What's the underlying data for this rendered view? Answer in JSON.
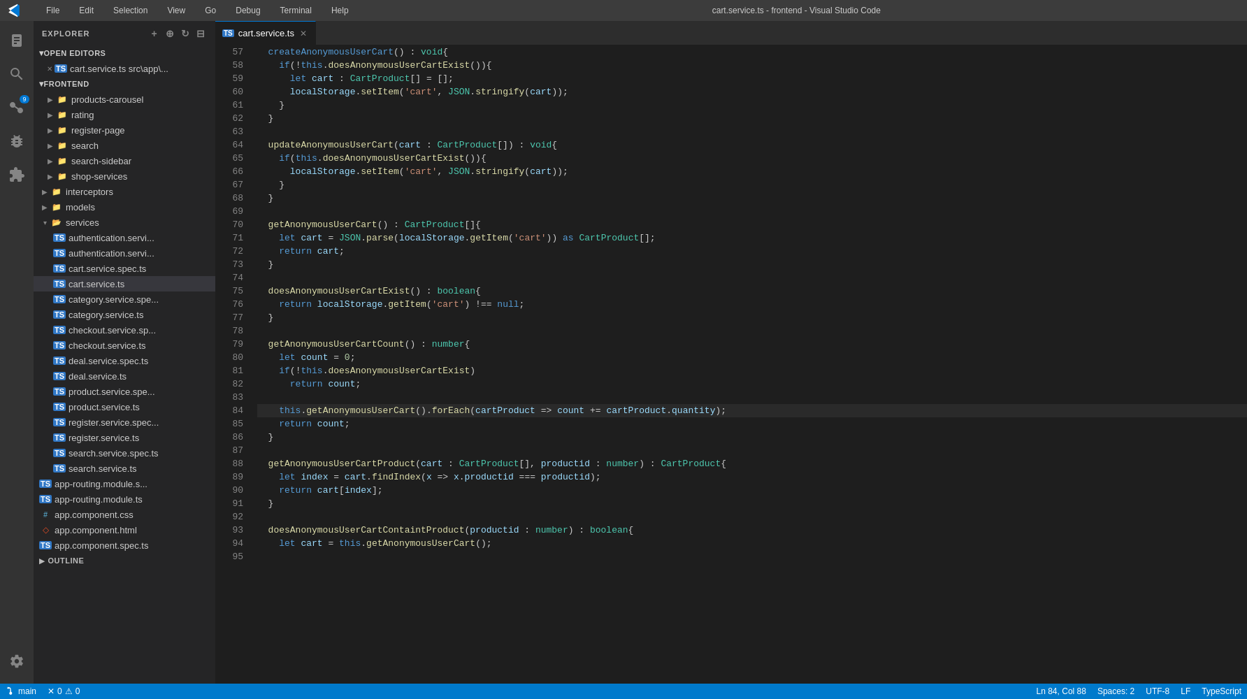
{
  "titlebar": {
    "title": "cart.service.ts - frontend - Visual Studio Code",
    "menus": [
      "File",
      "Edit",
      "Selection",
      "View",
      "Go",
      "Debug",
      "Terminal",
      "Help"
    ]
  },
  "activity_bar": {
    "icons": [
      {
        "name": "explorer",
        "symbol": "⎘",
        "active": false
      },
      {
        "name": "search",
        "symbol": "🔍",
        "active": false
      },
      {
        "name": "source-control",
        "symbol": "⑂",
        "active": false,
        "badge": "9"
      },
      {
        "name": "debug",
        "symbol": "🐛",
        "active": false
      },
      {
        "name": "extensions",
        "symbol": "⊞",
        "active": false
      }
    ],
    "gear_symbol": "⚙"
  },
  "sidebar": {
    "title": "Explorer",
    "sections": {
      "open_editors": {
        "label": "Open Editors",
        "files": [
          {
            "name": "cart.service.ts",
            "path": "src\\app\\...",
            "type": "ts"
          }
        ]
      },
      "frontend": {
        "label": "FRONTEND",
        "tree": [
          {
            "label": "products-carousel",
            "type": "folder",
            "depth": 1,
            "collapsed": true
          },
          {
            "label": "rating",
            "type": "folder",
            "depth": 1,
            "collapsed": true
          },
          {
            "label": "register-page",
            "type": "folder",
            "depth": 1,
            "collapsed": true
          },
          {
            "label": "search",
            "type": "folder",
            "depth": 1,
            "collapsed": true
          },
          {
            "label": "search-sidebar",
            "type": "folder",
            "depth": 1,
            "collapsed": true
          },
          {
            "label": "shop-services",
            "type": "folder",
            "depth": 1,
            "collapsed": true
          },
          {
            "label": "interceptors",
            "type": "folder",
            "depth": 0,
            "collapsed": true
          },
          {
            "label": "models",
            "type": "folder",
            "depth": 0,
            "collapsed": true
          },
          {
            "label": "services",
            "type": "folder",
            "depth": 0,
            "collapsed": false
          },
          {
            "label": "authentication.servi...",
            "type": "ts",
            "depth": 1
          },
          {
            "label": "authentication.servi...",
            "type": "ts",
            "depth": 1
          },
          {
            "label": "cart.service.spec.ts",
            "type": "ts",
            "depth": 1
          },
          {
            "label": "cart.service.ts",
            "type": "ts",
            "depth": 1,
            "active": true
          },
          {
            "label": "category.service.spe...",
            "type": "ts",
            "depth": 1
          },
          {
            "label": "category.service.ts",
            "type": "ts",
            "depth": 1
          },
          {
            "label": "checkout.service.sp...",
            "type": "ts",
            "depth": 1
          },
          {
            "label": "checkout.service.ts",
            "type": "ts",
            "depth": 1
          },
          {
            "label": "deal.service.spec.ts",
            "type": "ts",
            "depth": 1
          },
          {
            "label": "deal.service.ts",
            "type": "ts",
            "depth": 1
          },
          {
            "label": "product.service.spe...",
            "type": "ts",
            "depth": 1
          },
          {
            "label": "product.service.ts",
            "type": "ts",
            "depth": 1
          },
          {
            "label": "register.service.spec...",
            "type": "ts",
            "depth": 1
          },
          {
            "label": "register.service.ts",
            "type": "ts",
            "depth": 1
          },
          {
            "label": "search.service.spec.ts",
            "type": "ts",
            "depth": 1
          },
          {
            "label": "search.service.ts",
            "type": "ts",
            "depth": 1
          },
          {
            "label": "app-routing.module.s...",
            "type": "ts",
            "depth": 0
          },
          {
            "label": "app-routing.module.ts",
            "type": "ts",
            "depth": 0
          },
          {
            "label": "app.component.css",
            "type": "css",
            "depth": 0
          },
          {
            "label": "app.component.html",
            "type": "html",
            "depth": 0
          },
          {
            "label": "app.component.spec.ts",
            "type": "ts",
            "depth": 0
          }
        ]
      },
      "outline": {
        "label": "OUTLINE"
      }
    }
  },
  "editor": {
    "tab": {
      "filename": "cart.service.ts",
      "type": "ts"
    },
    "lines": [
      {
        "num": 57,
        "code": "  createAnonymousUserCart() : void{"
      },
      {
        "num": 58,
        "code": "    if(!this.doesAnonymousUserCartExist()){"
      },
      {
        "num": 59,
        "code": "      let cart : CartProduct[] = [];"
      },
      {
        "num": 60,
        "code": "      localStorage.setItem('cart', JSON.stringify(cart));"
      },
      {
        "num": 61,
        "code": "    }"
      },
      {
        "num": 62,
        "code": "  }"
      },
      {
        "num": 63,
        "code": ""
      },
      {
        "num": 64,
        "code": "  updateAnonymousUserCart(cart : CartProduct[]) : void{"
      },
      {
        "num": 65,
        "code": "    if(this.doesAnonymousUserCartExist()){"
      },
      {
        "num": 66,
        "code": "      localStorage.setItem('cart', JSON.stringify(cart));"
      },
      {
        "num": 67,
        "code": "    }"
      },
      {
        "num": 68,
        "code": "  }"
      },
      {
        "num": 69,
        "code": ""
      },
      {
        "num": 70,
        "code": "  getAnonymousUserCart() : CartProduct[]{"
      },
      {
        "num": 71,
        "code": "    let cart = JSON.parse(localStorage.getItem('cart')) as CartProduct[];"
      },
      {
        "num": 72,
        "code": "    return cart;"
      },
      {
        "num": 73,
        "code": "  }"
      },
      {
        "num": 74,
        "code": ""
      },
      {
        "num": 75,
        "code": "  doesAnonymousUserCartExist() : boolean{"
      },
      {
        "num": 76,
        "code": "    return localStorage.getItem('cart') !== null;"
      },
      {
        "num": 77,
        "code": "  }"
      },
      {
        "num": 78,
        "code": ""
      },
      {
        "num": 79,
        "code": "  getAnonymousUserCartCount() : number{"
      },
      {
        "num": 80,
        "code": "    let count = 0;"
      },
      {
        "num": 81,
        "code": "    if(!this.doesAnonymousUserCartExist)"
      },
      {
        "num": 82,
        "code": "      return count;"
      },
      {
        "num": 83,
        "code": ""
      },
      {
        "num": 84,
        "code": "    this.getAnonymousUserCart().forEach(cartProduct => count += cartProduct.quantity);"
      },
      {
        "num": 85,
        "code": "    return count;"
      },
      {
        "num": 86,
        "code": "  }"
      },
      {
        "num": 87,
        "code": ""
      },
      {
        "num": 88,
        "code": "  getAnonymousUserCartProduct(cart : CartProduct[], productid : number) : CartProduct{"
      },
      {
        "num": 89,
        "code": "    let index = cart.findIndex(x => x.productid === productid);"
      },
      {
        "num": 90,
        "code": "    return cart[index];"
      },
      {
        "num": 91,
        "code": "  }"
      },
      {
        "num": 92,
        "code": ""
      },
      {
        "num": 93,
        "code": "  doesAnonymousUserCartContaintProduct(productid : number) : boolean{"
      },
      {
        "num": 94,
        "code": "    let cart = this.getAnonymousUserCart();"
      },
      {
        "num": 95,
        "code": ""
      }
    ]
  },
  "status_bar": {
    "branch": "main",
    "errors": "0",
    "warnings": "0",
    "line_col": "Ln 84, Col 88",
    "spaces": "Spaces: 2",
    "encoding": "UTF-8",
    "line_ending": "LF",
    "language": "TypeScript"
  }
}
